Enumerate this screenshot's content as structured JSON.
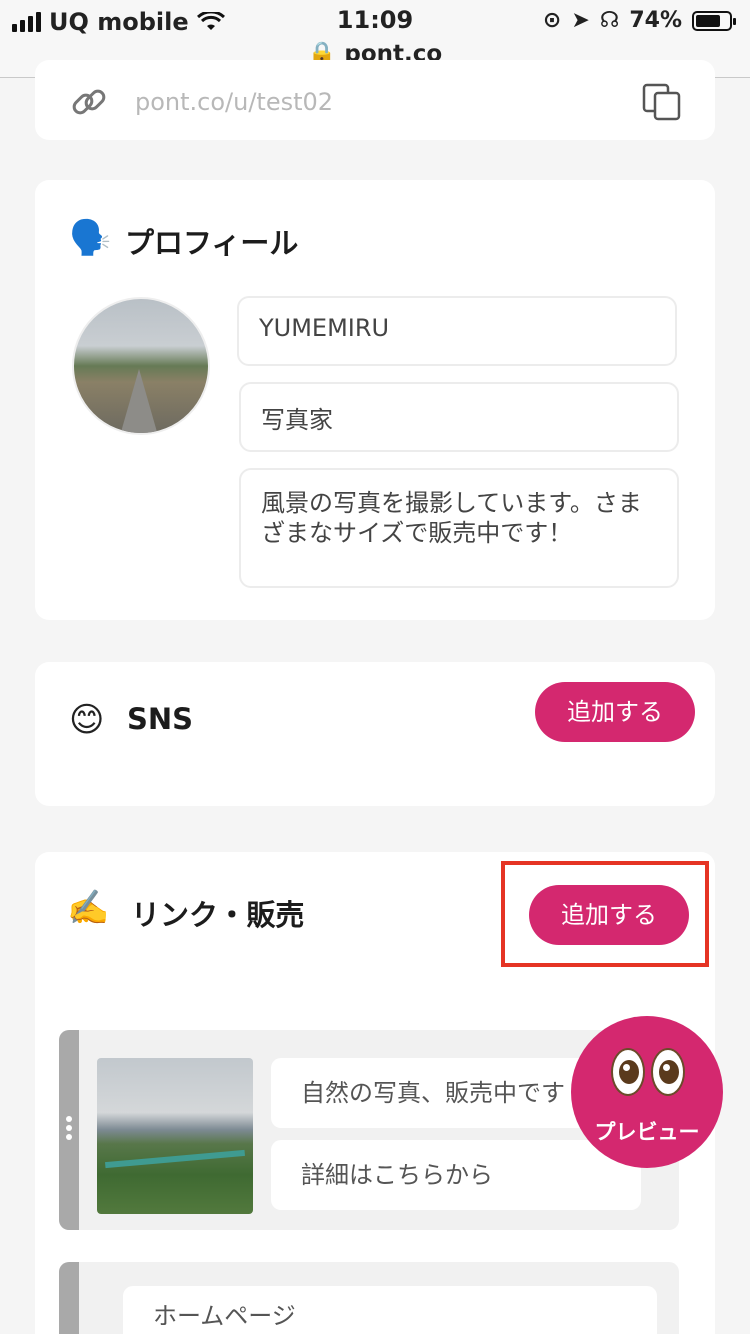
{
  "status_bar": {
    "carrier": "UQ mobile",
    "time": "11:09",
    "url": "pont.co",
    "battery": "74%",
    "battery_level": 0.74
  },
  "share_link": {
    "url": "pont.co/u/test02"
  },
  "profile": {
    "title": "プロフィール",
    "emoji": "🗣️",
    "name": "YUMEMIRU",
    "occupation": "写真家",
    "bio": "風景の写真を撮影しています。さまざまなサイズで販売中です！"
  },
  "sns": {
    "title": "SNS",
    "emoji": "😊",
    "add_label": "追加する"
  },
  "links": {
    "title": "リンク・販売",
    "emoji": "✍️",
    "add_label": "追加する",
    "items": [
      {
        "title": "自然の写真、販売中です",
        "subtitle": "詳細はこちらから"
      },
      {
        "title": "ホームページ"
      }
    ]
  },
  "preview": {
    "label": "プレビュー"
  },
  "accent_color": "#d4286f",
  "highlight_color": "#e53424"
}
